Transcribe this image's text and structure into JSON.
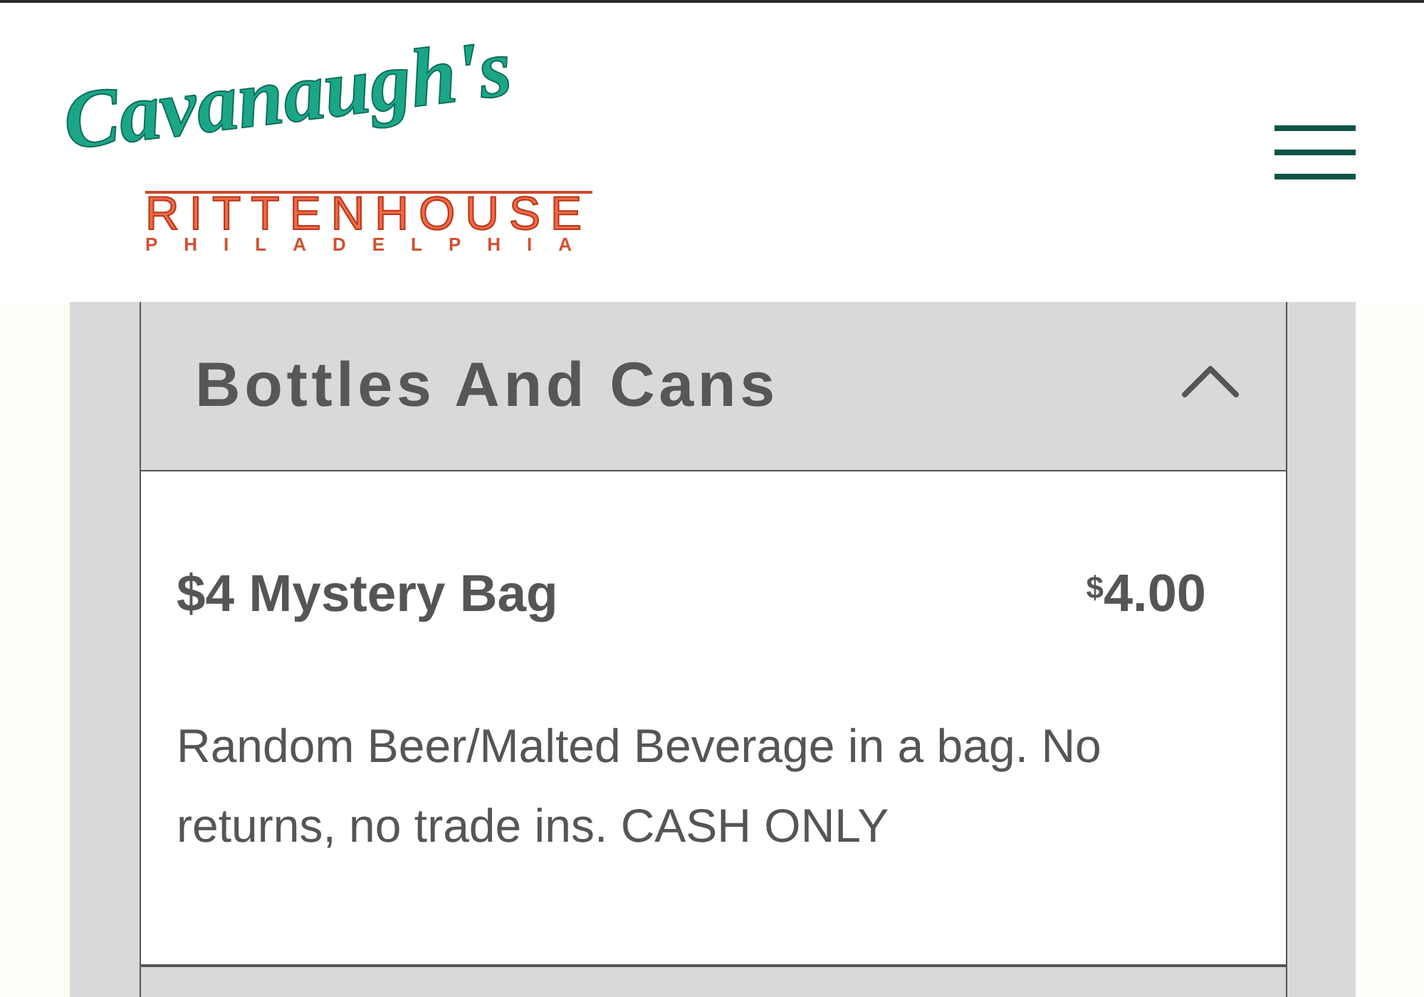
{
  "header": {
    "logo": {
      "script": "Cavanaugh's",
      "name": "RITTENHOUSE",
      "city": "PHILADELPHIA"
    }
  },
  "sections": [
    {
      "title": "Bottles And Cans",
      "expanded": true,
      "items": [
        {
          "name": "$4 Mystery Bag",
          "price": "$^{$}$4.00",
          "description": "Random Beer/Malted Beverage in a bag. No returns, no trade ins. CASH ONLY"
        }
      ]
    }
  ]
}
